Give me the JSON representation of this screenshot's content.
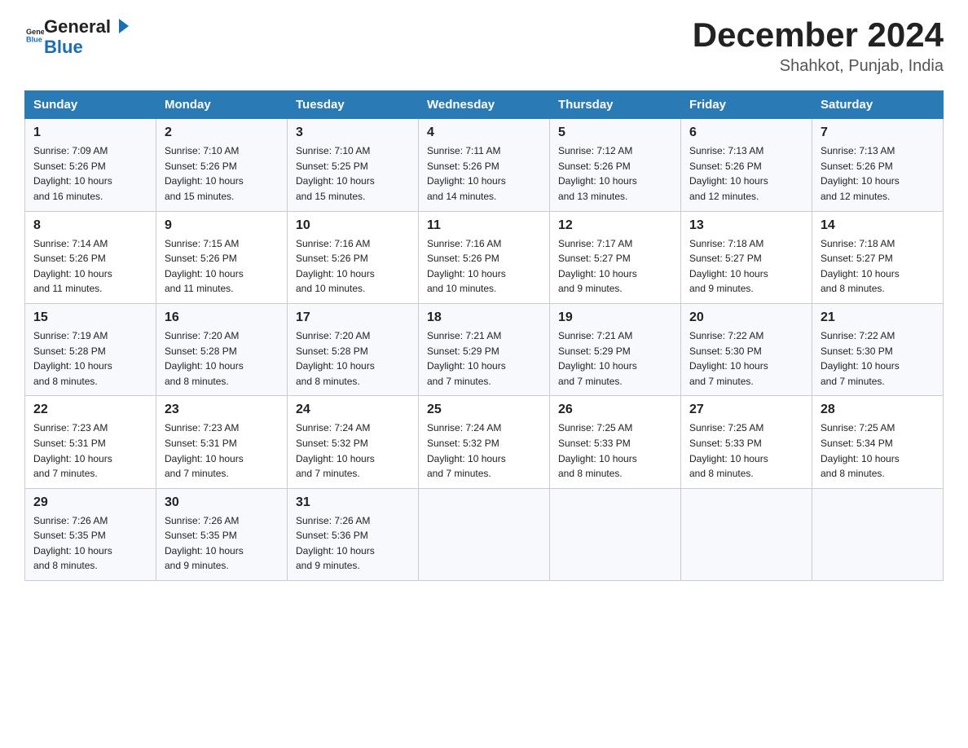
{
  "header": {
    "logo_general": "General",
    "logo_blue": "Blue",
    "title": "December 2024",
    "subtitle": "Shahkot, Punjab, India"
  },
  "days_of_week": [
    "Sunday",
    "Monday",
    "Tuesday",
    "Wednesday",
    "Thursday",
    "Friday",
    "Saturday"
  ],
  "weeks": [
    [
      {
        "day": "1",
        "sunrise": "7:09 AM",
        "sunset": "5:26 PM",
        "daylight": "10 hours and 16 minutes."
      },
      {
        "day": "2",
        "sunrise": "7:10 AM",
        "sunset": "5:26 PM",
        "daylight": "10 hours and 15 minutes."
      },
      {
        "day": "3",
        "sunrise": "7:10 AM",
        "sunset": "5:25 PM",
        "daylight": "10 hours and 15 minutes."
      },
      {
        "day": "4",
        "sunrise": "7:11 AM",
        "sunset": "5:26 PM",
        "daylight": "10 hours and 14 minutes."
      },
      {
        "day": "5",
        "sunrise": "7:12 AM",
        "sunset": "5:26 PM",
        "daylight": "10 hours and 13 minutes."
      },
      {
        "day": "6",
        "sunrise": "7:13 AM",
        "sunset": "5:26 PM",
        "daylight": "10 hours and 12 minutes."
      },
      {
        "day": "7",
        "sunrise": "7:13 AM",
        "sunset": "5:26 PM",
        "daylight": "10 hours and 12 minutes."
      }
    ],
    [
      {
        "day": "8",
        "sunrise": "7:14 AM",
        "sunset": "5:26 PM",
        "daylight": "10 hours and 11 minutes."
      },
      {
        "day": "9",
        "sunrise": "7:15 AM",
        "sunset": "5:26 PM",
        "daylight": "10 hours and 11 minutes."
      },
      {
        "day": "10",
        "sunrise": "7:16 AM",
        "sunset": "5:26 PM",
        "daylight": "10 hours and 10 minutes."
      },
      {
        "day": "11",
        "sunrise": "7:16 AM",
        "sunset": "5:26 PM",
        "daylight": "10 hours and 10 minutes."
      },
      {
        "day": "12",
        "sunrise": "7:17 AM",
        "sunset": "5:27 PM",
        "daylight": "10 hours and 9 minutes."
      },
      {
        "day": "13",
        "sunrise": "7:18 AM",
        "sunset": "5:27 PM",
        "daylight": "10 hours and 9 minutes."
      },
      {
        "day": "14",
        "sunrise": "7:18 AM",
        "sunset": "5:27 PM",
        "daylight": "10 hours and 8 minutes."
      }
    ],
    [
      {
        "day": "15",
        "sunrise": "7:19 AM",
        "sunset": "5:28 PM",
        "daylight": "10 hours and 8 minutes."
      },
      {
        "day": "16",
        "sunrise": "7:20 AM",
        "sunset": "5:28 PM",
        "daylight": "10 hours and 8 minutes."
      },
      {
        "day": "17",
        "sunrise": "7:20 AM",
        "sunset": "5:28 PM",
        "daylight": "10 hours and 8 minutes."
      },
      {
        "day": "18",
        "sunrise": "7:21 AM",
        "sunset": "5:29 PM",
        "daylight": "10 hours and 7 minutes."
      },
      {
        "day": "19",
        "sunrise": "7:21 AM",
        "sunset": "5:29 PM",
        "daylight": "10 hours and 7 minutes."
      },
      {
        "day": "20",
        "sunrise": "7:22 AM",
        "sunset": "5:30 PM",
        "daylight": "10 hours and 7 minutes."
      },
      {
        "day": "21",
        "sunrise": "7:22 AM",
        "sunset": "5:30 PM",
        "daylight": "10 hours and 7 minutes."
      }
    ],
    [
      {
        "day": "22",
        "sunrise": "7:23 AM",
        "sunset": "5:31 PM",
        "daylight": "10 hours and 7 minutes."
      },
      {
        "day": "23",
        "sunrise": "7:23 AM",
        "sunset": "5:31 PM",
        "daylight": "10 hours and 7 minutes."
      },
      {
        "day": "24",
        "sunrise": "7:24 AM",
        "sunset": "5:32 PM",
        "daylight": "10 hours and 7 minutes."
      },
      {
        "day": "25",
        "sunrise": "7:24 AM",
        "sunset": "5:32 PM",
        "daylight": "10 hours and 7 minutes."
      },
      {
        "day": "26",
        "sunrise": "7:25 AM",
        "sunset": "5:33 PM",
        "daylight": "10 hours and 8 minutes."
      },
      {
        "day": "27",
        "sunrise": "7:25 AM",
        "sunset": "5:33 PM",
        "daylight": "10 hours and 8 minutes."
      },
      {
        "day": "28",
        "sunrise": "7:25 AM",
        "sunset": "5:34 PM",
        "daylight": "10 hours and 8 minutes."
      }
    ],
    [
      {
        "day": "29",
        "sunrise": "7:26 AM",
        "sunset": "5:35 PM",
        "daylight": "10 hours and 8 minutes."
      },
      {
        "day": "30",
        "sunrise": "7:26 AM",
        "sunset": "5:35 PM",
        "daylight": "10 hours and 9 minutes."
      },
      {
        "day": "31",
        "sunrise": "7:26 AM",
        "sunset": "5:36 PM",
        "daylight": "10 hours and 9 minutes."
      },
      null,
      null,
      null,
      null
    ]
  ],
  "labels": {
    "sunrise": "Sunrise:",
    "sunset": "Sunset:",
    "daylight": "Daylight:"
  }
}
